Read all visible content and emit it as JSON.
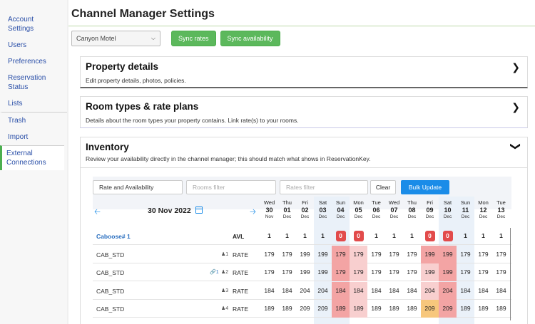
{
  "sidebar": {
    "items": [
      {
        "label": "Account Settings"
      },
      {
        "label": "Users"
      },
      {
        "label": "Preferences"
      },
      {
        "label": "Reservation Status"
      },
      {
        "label": "Lists"
      },
      {
        "label": "Trash"
      },
      {
        "label": "Import"
      },
      {
        "label": "External Connections"
      }
    ]
  },
  "header": {
    "title": "Channel Manager Settings"
  },
  "controls": {
    "property_select": "Canyon Motel",
    "sync_rates": "Sync rates",
    "sync_availability": "Sync availability"
  },
  "panels": {
    "property": {
      "title": "Property details",
      "desc": "Edit property details, photos, policies."
    },
    "rooms": {
      "title": "Room types & rate plans",
      "desc": "Details about the room types your property contains. Link rate(s) to your rooms."
    },
    "inventory": {
      "title": "Inventory",
      "desc": "Review your availability directly in the channel manager; this should match what shows in ReservationKey."
    }
  },
  "inventory": {
    "view_select": "Rate and Availability",
    "rooms_filter_placeholder": "Rooms filter",
    "rates_filter_placeholder": "Rates filter",
    "clear_label": "Clear",
    "bulk_label": "Bulk Update",
    "date_label": "30 Nov 2022",
    "days": [
      {
        "dow": "Wed",
        "num": "30",
        "mon": "Nov"
      },
      {
        "dow": "Thu",
        "num": "01",
        "mon": "Dec"
      },
      {
        "dow": "Fri",
        "num": "02",
        "mon": "Dec"
      },
      {
        "dow": "Sat",
        "num": "03",
        "mon": "Dec"
      },
      {
        "dow": "Sun",
        "num": "04",
        "mon": "Dec"
      },
      {
        "dow": "Mon",
        "num": "05",
        "mon": "Dec"
      },
      {
        "dow": "Tue",
        "num": "06",
        "mon": "Dec"
      },
      {
        "dow": "Wed",
        "num": "07",
        "mon": "Dec"
      },
      {
        "dow": "Thu",
        "num": "08",
        "mon": "Dec"
      },
      {
        "dow": "Fri",
        "num": "09",
        "mon": "Dec"
      },
      {
        "dow": "Sat",
        "num": "10",
        "mon": "Dec"
      },
      {
        "dow": "Sun",
        "num": "11",
        "mon": "Dec"
      },
      {
        "dow": "Mon",
        "num": "12",
        "mon": "Dec"
      },
      {
        "dow": "Tue",
        "num": "13",
        "mon": "Dec"
      }
    ],
    "avl_row": {
      "room": "Caboose# 1",
      "tag": "AVL",
      "values": [
        "1",
        "1",
        "1",
        "1",
        "0",
        "0",
        "1",
        "1",
        "1",
        "0",
        "0",
        "1",
        "1",
        "1"
      ]
    },
    "rate_rows": [
      {
        "code": "CAB_STD",
        "occ": "1",
        "tag": "RATE",
        "values": [
          "179",
          "179",
          "199",
          "199",
          "179",
          "179",
          "179",
          "179",
          "179",
          "199",
          "199",
          "179",
          "179",
          "179"
        ]
      },
      {
        "code": "CAB_STD",
        "occ": "2",
        "link": "1",
        "tag": "RATE",
        "values": [
          "179",
          "179",
          "199",
          "199",
          "179",
          "179",
          "179",
          "179",
          "179",
          "199",
          "199",
          "179",
          "179",
          "179"
        ]
      },
      {
        "code": "CAB_STD",
        "occ": "3",
        "tag": "RATE",
        "values": [
          "184",
          "184",
          "204",
          "204",
          "184",
          "184",
          "184",
          "184",
          "184",
          "204",
          "204",
          "184",
          "184",
          "184"
        ]
      },
      {
        "code": "CAB_STD",
        "occ": "4",
        "tag": "RATE",
        "values": [
          "189",
          "189",
          "209",
          "209",
          "189",
          "189",
          "189",
          "189",
          "189",
          "209",
          "209",
          "189",
          "189",
          "189"
        ]
      }
    ],
    "cell_styles": [
      [
        "",
        "",
        "",
        "",
        "",
        "",
        "",
        "",
        "",
        "",
        "",
        "",
        "",
        ""
      ],
      [
        "",
        "",
        "",
        "",
        "red",
        "pink",
        "",
        "",
        "",
        "red",
        "red",
        "",
        "",
        ""
      ],
      [
        "",
        "",
        "",
        "",
        "red",
        "pink",
        "",
        "",
        "",
        "pink",
        "red",
        "",
        "",
        ""
      ],
      [
        "",
        "",
        "",
        "",
        "red",
        "pink",
        "",
        "",
        "",
        "pink",
        "red",
        "",
        "",
        ""
      ],
      [
        "",
        "",
        "",
        "",
        "red",
        "pink",
        "",
        "",
        "",
        "orange",
        "red",
        "",
        "",
        ""
      ]
    ]
  },
  "icons": {
    "chevron_right": "chevron-right-icon",
    "chevron_down": "chevron-down-icon",
    "arrow_left": "arrow-left-icon",
    "arrow_right": "arrow-right-icon",
    "calendar": "calendar-icon",
    "person": "person-icon",
    "link": "link-icon"
  },
  "colors": {
    "accent_green": "#5cb85c",
    "accent_blue": "#1a8ce8",
    "closed_red": "#e24b4b"
  }
}
